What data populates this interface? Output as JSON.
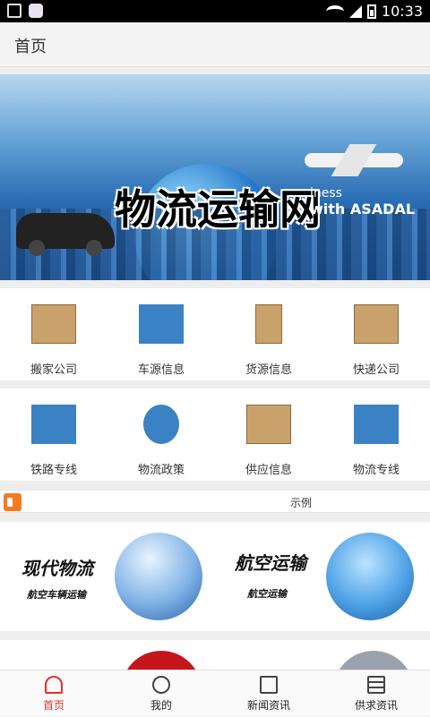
{
  "status_bar": {
    "time": "10:33"
  },
  "header": {
    "title": "首页"
  },
  "banner": {
    "title": "物流运输网",
    "tagline_top": "iness",
    "tagline_brand": "with ASADAL",
    "slides": 3,
    "active_slide": 1
  },
  "categories_row1": [
    {
      "label": "搬家公司",
      "icon": "moving-box-icon"
    },
    {
      "label": "车源信息",
      "icon": "delivery-truck-icon"
    },
    {
      "label": "货源信息",
      "icon": "hand-truck-icon"
    },
    {
      "label": "快递公司",
      "icon": "parcel-stack-icon"
    }
  ],
  "categories_row2": [
    {
      "label": "铁路专线",
      "icon": "blue-truck-icon"
    },
    {
      "label": "物流政策",
      "icon": "globe-cart-icon"
    },
    {
      "label": "供应信息",
      "icon": "box-pallet-icon"
    },
    {
      "label": "物流专线",
      "icon": "clock-truck-icon"
    }
  ],
  "notice": {
    "text": "示例",
    "icon": "speaker-icon"
  },
  "feature_cards": [
    {
      "title": "现代物流",
      "subtitle": "航空车辆运输"
    },
    {
      "title": "航空运输",
      "subtitle": "航空运输"
    }
  ],
  "tabbar": [
    {
      "label": "首页",
      "icon": "home-icon",
      "active": true
    },
    {
      "label": "我的",
      "icon": "user-icon",
      "active": false
    },
    {
      "label": "新闻资讯",
      "icon": "news-icon",
      "active": false
    },
    {
      "label": "供求资讯",
      "icon": "document-icon",
      "active": false
    }
  ],
  "colors": {
    "accent": "#e0322a",
    "notice_icon": "#f47b20"
  }
}
